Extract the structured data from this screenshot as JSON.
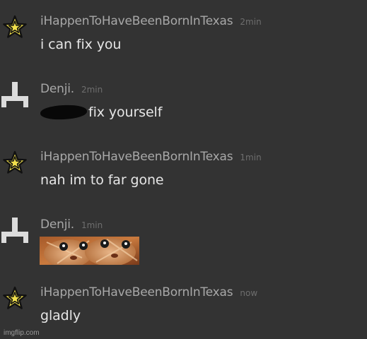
{
  "messages": [
    {
      "user": "iHappenToHaveBeenBornInTexas",
      "time": "2min",
      "text": "i can fix you",
      "avatar_icon": "star-icon"
    },
    {
      "user": "Denji.",
      "time": "2min",
      "text": "fix yourself",
      "avatar_icon": "tau-cross-icon",
      "redacted_prefix": true
    },
    {
      "user": "iHappenToHaveBeenBornInTexas",
      "time": "1min",
      "text": "nah im to far gone",
      "avatar_icon": "star-icon"
    },
    {
      "user": "Denji.",
      "time": "1min",
      "attachment": "image",
      "avatar_icon": "tau-cross-icon"
    },
    {
      "user": "iHappenToHaveBeenBornInTexas",
      "time": "now",
      "text": "gladly",
      "avatar_icon": "star-icon"
    }
  ],
  "watermark": "imgflip.com",
  "colors": {
    "background": "#333333",
    "username": "#a8a8a8",
    "timestamp": "#6e6e6e",
    "message_text": "#e6e6e6",
    "star_fill": "#f2e14c"
  }
}
